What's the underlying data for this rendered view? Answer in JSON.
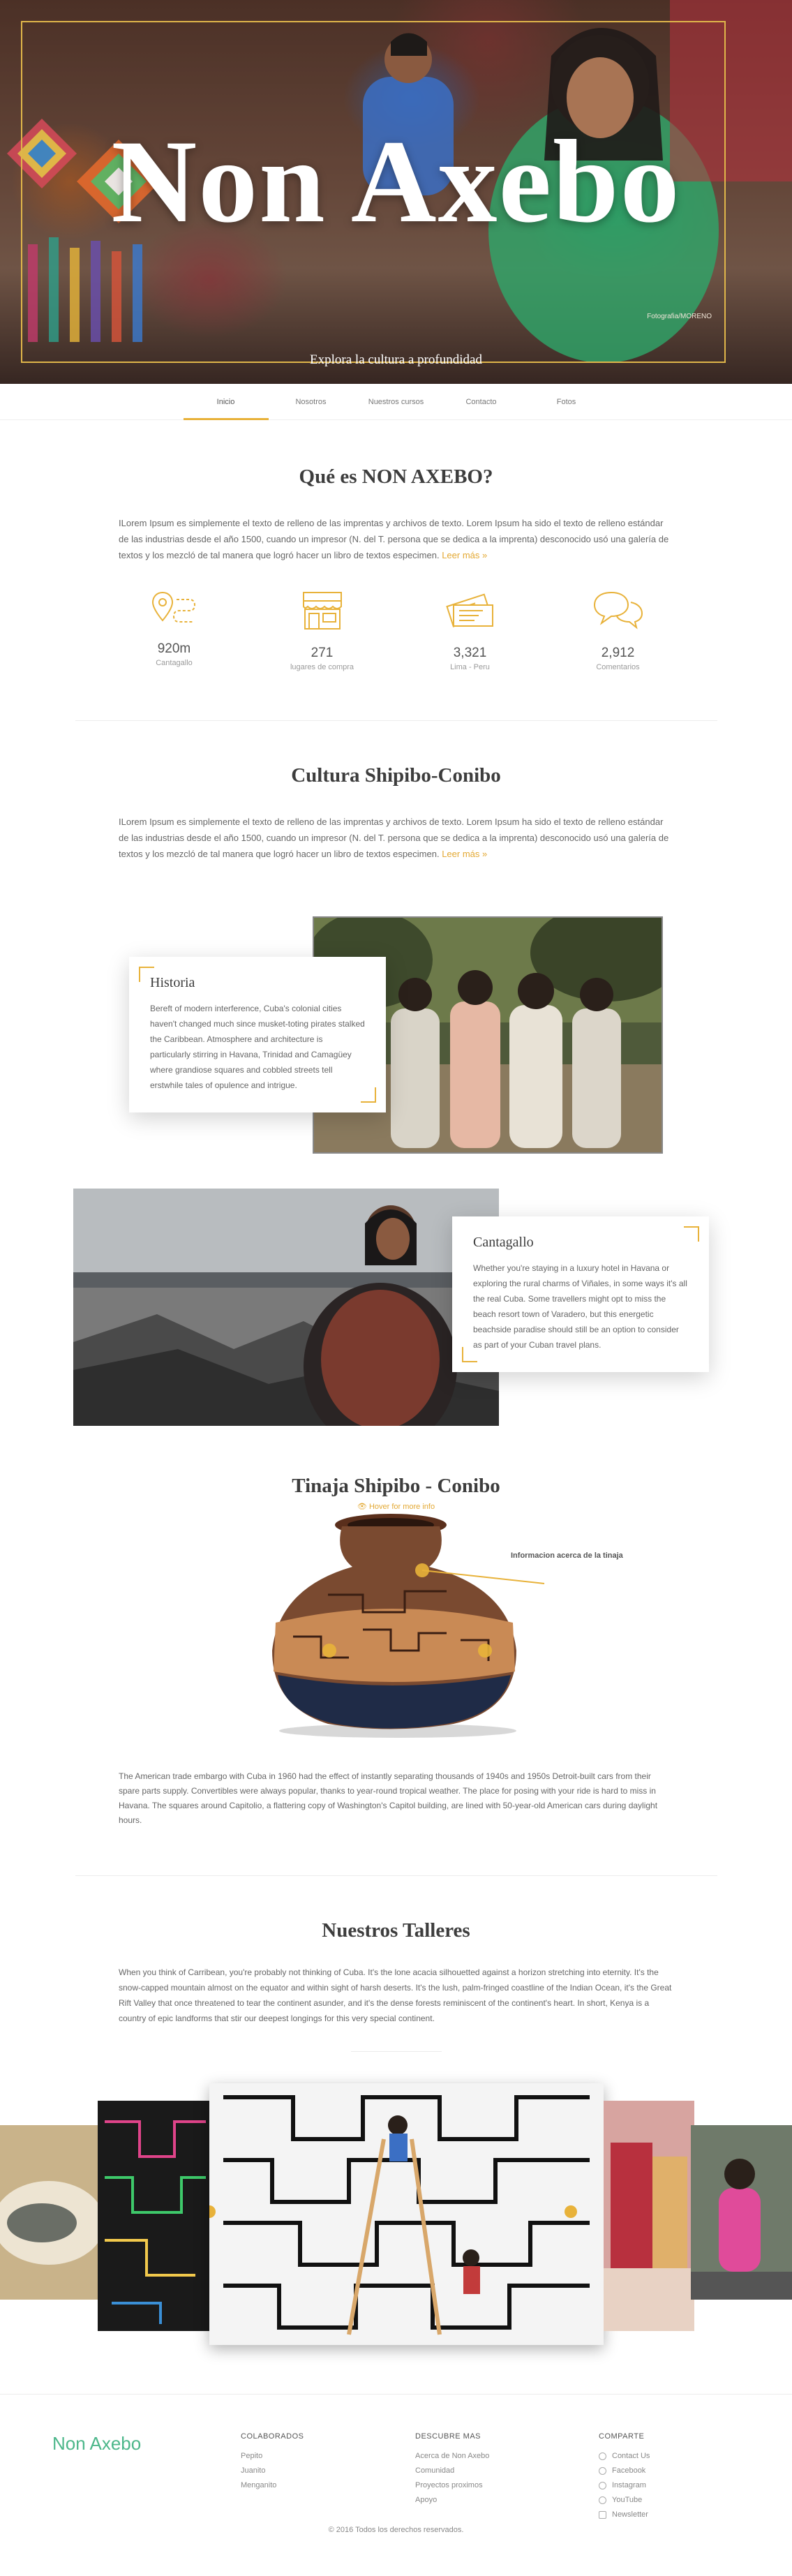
{
  "hero": {
    "title": "Non Axebo",
    "subtitle": "Explora la cultura a profundidad",
    "credit": "Fotografia/MORENO"
  },
  "nav": {
    "items": [
      {
        "label": "Inicio",
        "active": true
      },
      {
        "label": "Nosotros",
        "active": false
      },
      {
        "label": "Nuestros cursos",
        "active": false
      },
      {
        "label": "Contacto",
        "active": false
      },
      {
        "label": "Fotos",
        "active": false
      }
    ]
  },
  "about": {
    "title": "Qué es NON AXEBO?",
    "text": "ILorem Ipsum es simplemente el texto de relleno de las imprentas y archivos de texto. Lorem Ipsum ha sido el texto de relleno estándar de las industrias desde el año 1500, cuando un impresor (N. del T. persona que se dedica a la imprenta) desconocido usó una galería de textos y los mezcló de tal manera que logró hacer un libro de textos especimen.",
    "more": "Leer más »"
  },
  "stats": [
    {
      "icon": "location-route-icon",
      "value": "920m",
      "label": "Cantagallo"
    },
    {
      "icon": "store-icon",
      "value": "271",
      "label": "lugares de compra"
    },
    {
      "icon": "tickets-icon",
      "value": "3,321",
      "label": "Lima - Peru"
    },
    {
      "icon": "chat-bubbles-icon",
      "value": "2,912",
      "label": "Comentarios"
    }
  ],
  "culture": {
    "title": "Cultura Shipibo-Conibo",
    "text": "ILorem Ipsum es simplemente el texto de relleno de las imprentas y archivos de texto. Lorem Ipsum ha sido el texto de relleno estándar de las industrias desde el año 1500, cuando un impresor (N. del T. persona que se dedica a la imprenta) desconocido usó una galería de textos y los mezcló de tal manera que logró hacer un libro de textos especimen.",
    "more": "Leer más »"
  },
  "historia": {
    "title": "Historia",
    "text": "Bereft of modern interference, Cuba's colonial cities haven't changed much since musket-toting pirates stalked the Caribbean. Atmosphere and architecture is particularly stirring in Havana, Trinidad and Camagüey where grandiose squares and cobbled streets tell erstwhile tales of opulence and intrigue."
  },
  "cantagallo": {
    "title": "Cantagallo",
    "text": "Whether you're staying in a luxury hotel in Havana or exploring the rural charms of Viñales, in some ways it's all the real Cuba. Some travellers might opt to miss the beach resort town of Varadero, but this energetic beachside paradise should still  be an option to consider as part of your Cuban travel plans."
  },
  "tinaja": {
    "title": "Tinaja Shipibo - Conibo",
    "hint": "Hover for more info",
    "annotation": "Informacion acerca de la tinaja",
    "text": "The American trade embargo with Cuba in 1960 had the effect of instantly separating thousands of 1940s and 1950s Detroit-built cars from their spare parts supply. Convertibles were always popular, thanks to year-round tropical weather. The place for posing with your ride is hard to miss in Havana. The squares around Capitolio, a flattering copy of Washington's Capitol building, are lined with 50-year-old American cars during daylight hours."
  },
  "talleres": {
    "title": "Nuestros Talleres",
    "text": "When you think of Carribean, you're probably not thinking of Cuba. It's the lone acacia silhouetted against a horizon stretching into eternity. It's the snow-capped mountain almost on the equator and within sight of harsh deserts. It's the lush, palm-fringed coastline of the Indian Ocean, it's the Great Rift Valley that once threatened to tear the continent asunder, and it's the dense forests reminiscent of the continent's heart. In short, Kenya is a country of epic landforms that stir our deepest longings for this very special continent."
  },
  "footer": {
    "logo": "Non Axebo",
    "colaborados": {
      "title": "COLABORADOS",
      "items": [
        "Pepito",
        "Juanito",
        "Menganito"
      ]
    },
    "descubre": {
      "title": "DESCUBRE MAS",
      "items": [
        "Acerca de Non Axebo",
        "Comunidad",
        "Proyectos proximos",
        "Apoyo"
      ]
    },
    "comparte": {
      "title": "COMPARTE",
      "items": [
        {
          "label": "Contact Us",
          "icon": "mail-icon"
        },
        {
          "label": "Facebook",
          "icon": "facebook-icon"
        },
        {
          "label": "Instagram",
          "icon": "instagram-icon"
        },
        {
          "label": "YouTube",
          "icon": "youtube-icon"
        },
        {
          "label": "Newsletter",
          "icon": "newsletter-icon"
        }
      ]
    },
    "copyright": "© 2016 Todos los derechos reservados."
  },
  "colors": {
    "accent": "#e8b23a",
    "brand": "#4cb78a"
  }
}
